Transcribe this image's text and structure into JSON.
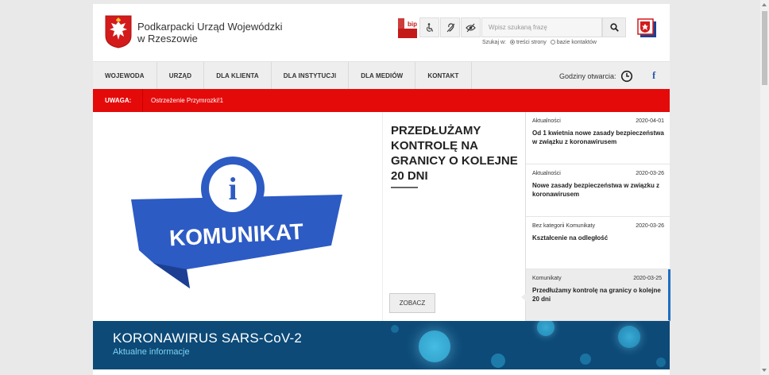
{
  "header": {
    "brand_line1": "Podkarpacki Urząd Wojewódzki",
    "brand_line2": "w Rzeszowie",
    "bip_label": "bip",
    "accessibility": [
      "wheelchair-icon",
      "hearing-icon",
      "eye-icon"
    ],
    "search_placeholder": "Wpisz szukaną frazę",
    "search_scope_label": "Szukaj w:",
    "search_scope_options": [
      "treści strony",
      "bazie kontaktów"
    ],
    "search_scope_selected": "treści strony"
  },
  "nav": {
    "items": [
      "WOJEWODA",
      "URZĄD",
      "DLA KLIENTA",
      "DLA INSTYTUCJI",
      "DLA MEDIÓW",
      "KONTAKT"
    ],
    "hours_label": "Godziny otwarcia:",
    "facebook": "f"
  },
  "alert": {
    "label": "UWAGA:",
    "text": "Ostrzeżenie Przymrozki!1"
  },
  "hero": {
    "image_text": "KOMUNIKAT",
    "image_icon": "i",
    "title": "PRZEDŁUŻAMY KONTROLĘ NA GRANICY O KOLEJNE 20 DNI",
    "button": "ZOBACZ"
  },
  "news": [
    {
      "category": "Aktualności",
      "date": "2020-04-01",
      "title": "Od 1 kwietnia nowe zasady bezpieczeństwa w związku z koronawirusem"
    },
    {
      "category": "Aktualności",
      "date": "2020-03-26",
      "title": "Nowe zasady bezpieczeństwa w związku z koronawirusem"
    },
    {
      "category": "Bez kategorii Komunikaty",
      "date": "2020-03-26",
      "title": "Kształcenie na odległość"
    },
    {
      "category": "Komunikaty",
      "date": "2020-03-25",
      "title": "Przedłużamy kontrolę na granicy o kolejne 20 dni",
      "active": true
    }
  ],
  "banner": {
    "title": "KORONAWIRUS SARS-CoV-2",
    "subtitle": "Aktualne informacje"
  },
  "colors": {
    "alert_red": "#e50a0a",
    "banner_blue": "#0d4a78",
    "komunikat_blue": "#2d5bc4",
    "accent_blue": "#1b6ec2"
  }
}
